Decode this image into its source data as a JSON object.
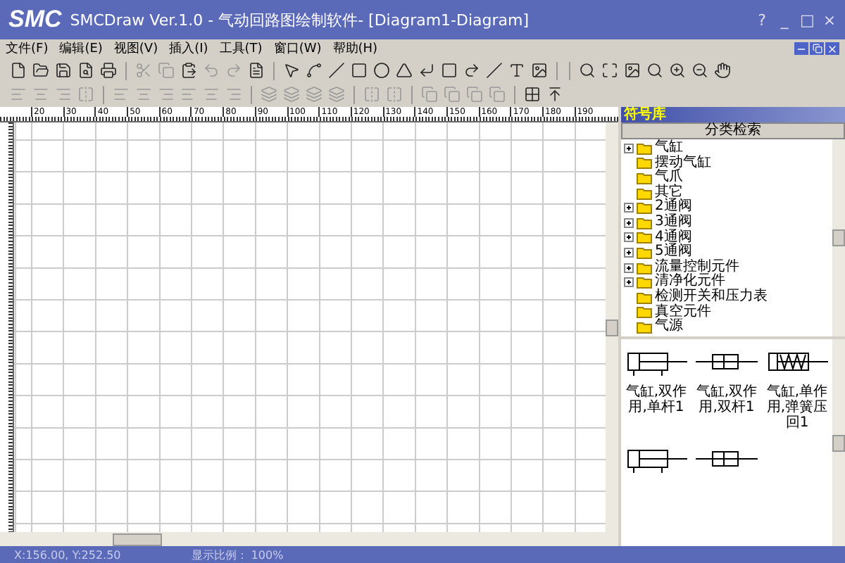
{
  "window": {
    "logo": "SMC",
    "title": "SMCDraw Ver.1.0 - 气动回路图绘制软件- [Diagram1-Diagram]",
    "controls": [
      "?",
      "_",
      "□",
      "×"
    ]
  },
  "menu": [
    "文件(F)",
    "编辑(E)",
    "视图(V)",
    "插入(I)",
    "工具(T)",
    "窗口(W)",
    "帮助(H)"
  ],
  "ruler": {
    "labels": [
      "20",
      "30",
      "40",
      "50",
      "60",
      "70",
      "80",
      "90",
      "100",
      "110",
      "120",
      "130",
      "140",
      "150",
      "160",
      "170",
      "180",
      "190"
    ]
  },
  "symbol_panel": {
    "title": "符号库",
    "search_button": "分类检索",
    "tree": [
      {
        "label": "气缸",
        "expandable": true
      },
      {
        "label": "摆动气缸",
        "expandable": false
      },
      {
        "label": "气爪",
        "expandable": false
      },
      {
        "label": "其它",
        "expandable": false
      },
      {
        "label": "2通阀",
        "expandable": true
      },
      {
        "label": "3通阀",
        "expandable": true
      },
      {
        "label": "4通阀",
        "expandable": true
      },
      {
        "label": "5通阀",
        "expandable": true
      },
      {
        "label": "流量控制元件",
        "expandable": true
      },
      {
        "label": "清净化元件",
        "expandable": true
      },
      {
        "label": "检测开关和压力表",
        "expandable": false
      },
      {
        "label": "真空元件",
        "expandable": false
      },
      {
        "label": "气源",
        "expandable": false
      }
    ],
    "symbols": [
      {
        "kind": "double",
        "label": "气缸,双作用,单杆1"
      },
      {
        "kind": "rod2",
        "label": "气缸,双作用,双杆1"
      },
      {
        "kind": "spring",
        "label": "气缸,单作用,弹簧压回1"
      }
    ]
  },
  "status_bar": {
    "coords": "X:156.00, Y:252.50",
    "zoom": "显示比例： 100%"
  }
}
